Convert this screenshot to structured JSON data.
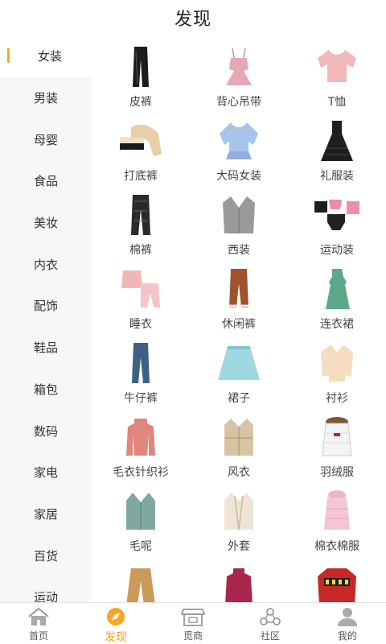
{
  "header": {
    "title": "发现"
  },
  "sidebar": {
    "items": [
      {
        "label": "女装",
        "active": true
      },
      {
        "label": "男装"
      },
      {
        "label": "母婴"
      },
      {
        "label": "食品"
      },
      {
        "label": "美妆"
      },
      {
        "label": "内衣"
      },
      {
        "label": "配饰"
      },
      {
        "label": "鞋品"
      },
      {
        "label": "箱包"
      },
      {
        "label": "数码"
      },
      {
        "label": "家电"
      },
      {
        "label": "家居"
      },
      {
        "label": "百货"
      },
      {
        "label": "运动"
      }
    ]
  },
  "grid": {
    "items": [
      {
        "label": "皮裤",
        "icon": "leather-pants-icon"
      },
      {
        "label": "背心吊带",
        "icon": "camisole-dress-icon"
      },
      {
        "label": "T恤",
        "icon": "tshirt-icon"
      },
      {
        "label": "打底裤",
        "icon": "leggings-icon"
      },
      {
        "label": "大码女装",
        "icon": "plus-size-top-icon"
      },
      {
        "label": "礼服装",
        "icon": "gown-icon"
      },
      {
        "label": "棉裤",
        "icon": "cotton-pants-icon"
      },
      {
        "label": "西装",
        "icon": "blazer-icon"
      },
      {
        "label": "运动装",
        "icon": "sportswear-icon"
      },
      {
        "label": "睡衣",
        "icon": "pajamas-icon"
      },
      {
        "label": "休闲裤",
        "icon": "casual-pants-icon"
      },
      {
        "label": "连衣裙",
        "icon": "dress-icon"
      },
      {
        "label": "牛仔裤",
        "icon": "jeans-icon"
      },
      {
        "label": "裙子",
        "icon": "skirt-icon"
      },
      {
        "label": "衬衫",
        "icon": "blouse-icon"
      },
      {
        "label": "毛衣针织衫",
        "icon": "sweater-icon"
      },
      {
        "label": "风衣",
        "icon": "trench-coat-icon"
      },
      {
        "label": "羽绒服",
        "icon": "down-jacket-icon"
      },
      {
        "label": "毛呢",
        "icon": "wool-coat-icon"
      },
      {
        "label": "外套",
        "icon": "cardigan-coat-icon"
      },
      {
        "label": "棉衣棉服",
        "icon": "padded-coat-icon"
      },
      {
        "label": "",
        "icon": "wide-pants-icon"
      },
      {
        "label": "",
        "icon": "knit-top-icon"
      },
      {
        "label": "",
        "icon": "printed-sweater-icon"
      }
    ]
  },
  "tabbar": {
    "items": [
      {
        "label": "首页",
        "icon": "home-icon"
      },
      {
        "label": "发现",
        "icon": "compass-icon",
        "active": true
      },
      {
        "label": "觅商",
        "icon": "shop-icon"
      },
      {
        "label": "社区",
        "icon": "community-icon"
      },
      {
        "label": "我的",
        "icon": "profile-icon"
      }
    ]
  },
  "colors": {
    "accent": "#f5a623",
    "sidebar_bg": "#f7f7f7",
    "text": "#333333"
  }
}
